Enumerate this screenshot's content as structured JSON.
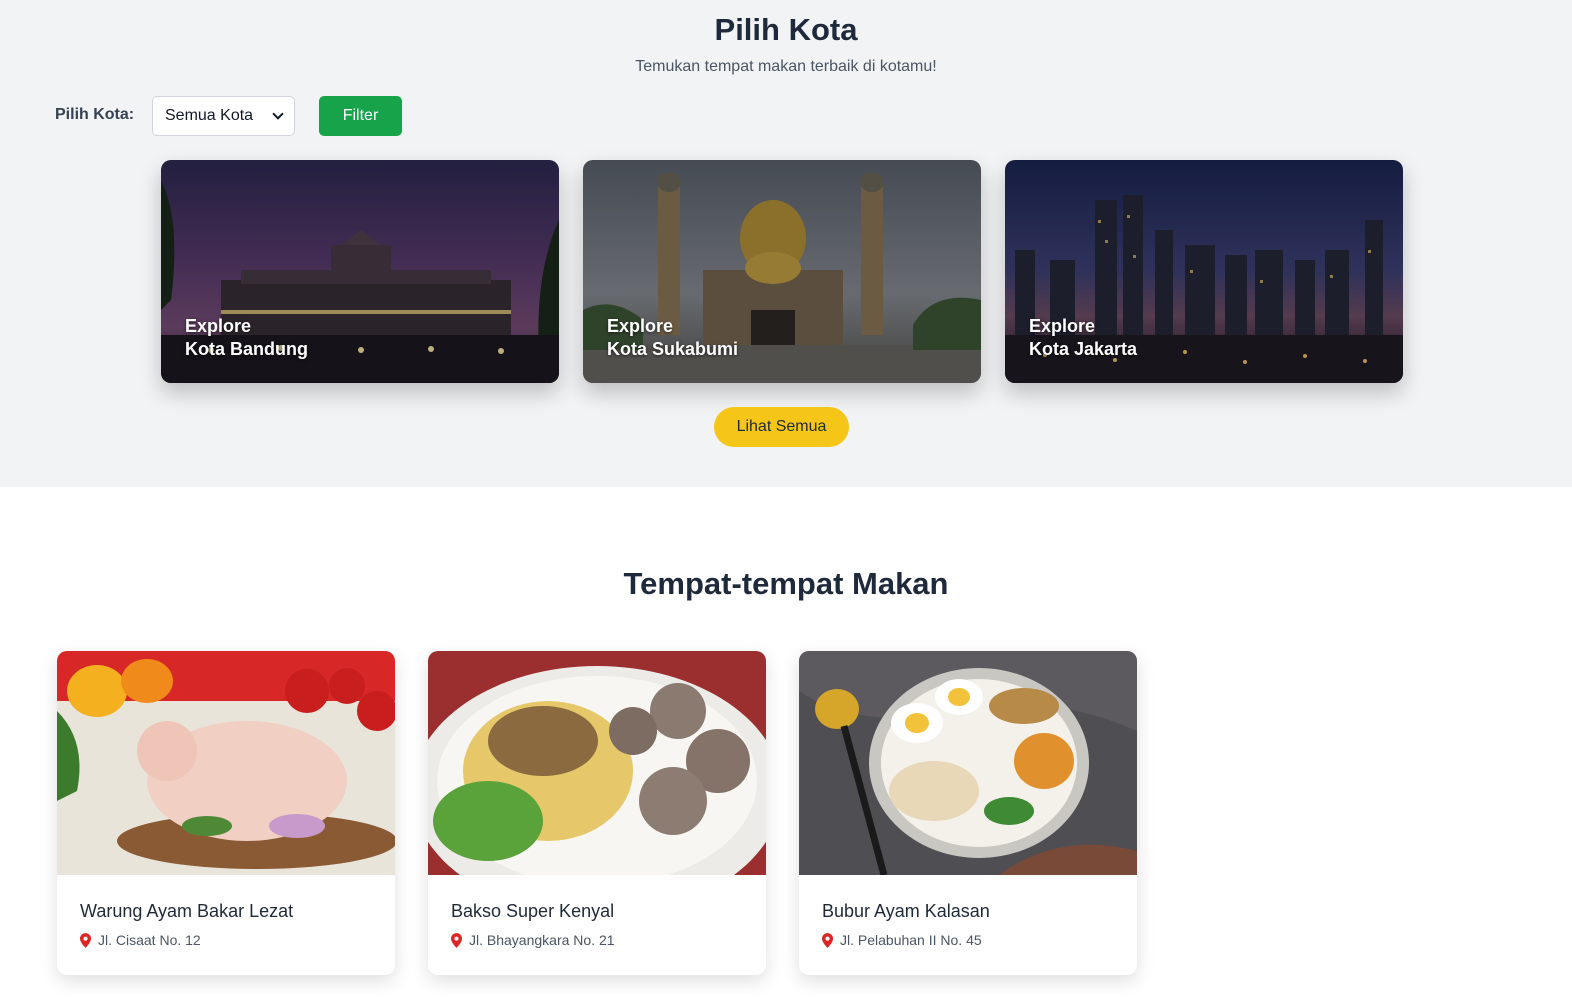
{
  "hero": {
    "title": "Pilih Kota",
    "subtitle": "Temukan tempat makan terbaik di kotamu!"
  },
  "filter": {
    "label": "Pilih Kota:",
    "selected": "Semua Kota",
    "button_label": "Filter"
  },
  "cities": [
    {
      "line1": "Explore",
      "line2": "Kota Bandung"
    },
    {
      "line1": "Explore",
      "line2": "Kota Sukabumi"
    },
    {
      "line1": "Explore",
      "line2": "Kota Jakarta"
    }
  ],
  "see_all_label": "Lihat Semua",
  "restaurants_section": {
    "title": "Tempat-tempat Makan",
    "items": [
      {
        "name": "Warung Ayam Bakar Lezat",
        "address": "Jl. Cisaat No. 12"
      },
      {
        "name": "Bakso Super Kenyal",
        "address": "Jl. Bhayangkara No. 21"
      },
      {
        "name": "Bubur Ayam Kalasan",
        "address": "Jl. Pelabuhan II No. 45"
      }
    ]
  },
  "colors": {
    "filter_button": "#16a34a",
    "see_all_button": "#f5c518",
    "pin": "#dc2626"
  },
  "icons": {
    "select_arrow": "chevron-down-icon",
    "address": "map-pin-icon"
  }
}
